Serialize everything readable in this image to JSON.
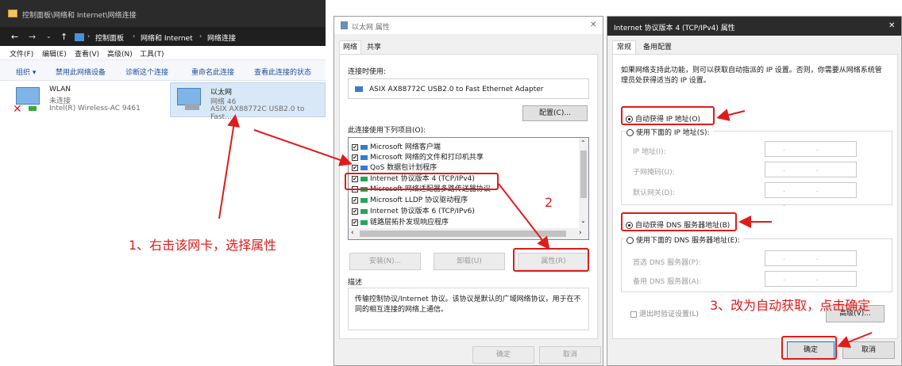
{
  "explorer": {
    "title": "控制面板\\网络和 Internet\\网络连接",
    "breadcrumb": [
      "控制面板",
      "网络和 Internet",
      "网络连接"
    ],
    "menu": [
      "文件(F)",
      "编辑(E)",
      "查看(V)",
      "高级(N)",
      "工具(T)"
    ],
    "commands": [
      "组织 ▾",
      "禁用此网络设备",
      "诊断这个连接",
      "重命名此连接",
      "查看此连接的状态"
    ],
    "adapters": [
      {
        "name": "WLAN",
        "status": "未连接",
        "device": "Intel(R) Wireless-AC 9461"
      },
      {
        "name": "以太网",
        "status": "网络 46",
        "device": "ASIX AX88772C USB2.0 to Fast..."
      }
    ]
  },
  "eth_props": {
    "title": "以太网 属性",
    "close": "✕",
    "tabs": [
      "网络",
      "共享"
    ],
    "connect_using_label": "连接时使用:",
    "adapter": "ASIX AX88772C USB2.0 to Fast Ethernet Adapter",
    "configure_btn": "配置(C)...",
    "items_label": "此连接使用下列项目(O):",
    "items": [
      {
        "label": "Microsoft 网络客户端",
        "checked": true,
        "color": "#2f7bd6"
      },
      {
        "label": "Microsoft 网络的文件和打印机共享",
        "checked": true,
        "color": "#2f7bd6"
      },
      {
        "label": "QoS 数据包计划程序",
        "checked": true,
        "color": "#2f7bd6"
      },
      {
        "label": "Internet 协议版本 4 (TCP/IPv4)",
        "checked": true,
        "color": "#2aa35a"
      },
      {
        "label": "Microsoft 网络适配器多路传送器协议",
        "checked": false,
        "color": "#2aa35a"
      },
      {
        "label": "Microsoft LLDP 协议驱动程序",
        "checked": true,
        "color": "#2aa35a"
      },
      {
        "label": "Internet 协议版本 6 (TCP/IPv6)",
        "checked": true,
        "color": "#2aa35a"
      },
      {
        "label": "链路层拓扑发现响应程序",
        "checked": true,
        "color": "#2aa35a"
      }
    ],
    "install_btn": "安装(N)...",
    "uninstall_btn": "卸载(U)",
    "properties_btn": "属性(R)",
    "desc_label": "描述",
    "desc_text": "传输控制协议/Internet 协议。该协议是默认的广域网络协议，用于在不同的相互连接的网络上通信。",
    "ok_btn": "确定",
    "cancel_btn": "取消"
  },
  "ipv4_props": {
    "title": "Internet 协议版本 4 (TCP/IPv4) 属性",
    "close": "✕",
    "tabs": [
      "常规",
      "备用配置"
    ],
    "intro": "如果网络支持此功能，则可以获取自动指派的 IP 设置。否则，你需要从网络系统管理员处获得适当的 IP 设置。",
    "auto_ip": "自动获得 IP 地址(O)",
    "manual_ip": "使用下面的 IP 地址(S):",
    "ip_label": "IP 地址(I):",
    "mask_label": "子网掩码(U):",
    "gateway_label": "默认网关(D):",
    "auto_dns": "自动获得 DNS 服务器地址(B)",
    "manual_dns": "使用下面的 DNS 服务器地址(E):",
    "pref_dns_label": "首选 DNS 服务器(P):",
    "alt_dns_label": "备用 DNS 服务器(A):",
    "ip_dots": ". . .",
    "validate_label": "退出时验证设置(L)",
    "advanced_btn": "高级(V)...",
    "ok_btn": "确定",
    "cancel_btn": "取消"
  },
  "annotations": {
    "step1": "1、右击该网卡，选择属性",
    "step2": "2",
    "step3": "3、改为自动获取，点击确定",
    "color": "#e11b1b"
  }
}
